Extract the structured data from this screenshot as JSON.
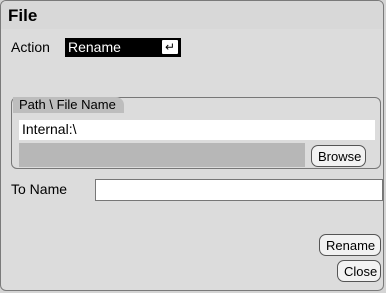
{
  "window": {
    "title": "File"
  },
  "action": {
    "label": "Action",
    "value": "Rename",
    "enter_symbol": "↵"
  },
  "path_group": {
    "title": "Path \\ File Name",
    "path_value": "Internal:\\",
    "browse_label": "Browse"
  },
  "to_name": {
    "label": "To Name",
    "value": ""
  },
  "buttons": {
    "rename": "Rename",
    "close": "Close"
  }
}
